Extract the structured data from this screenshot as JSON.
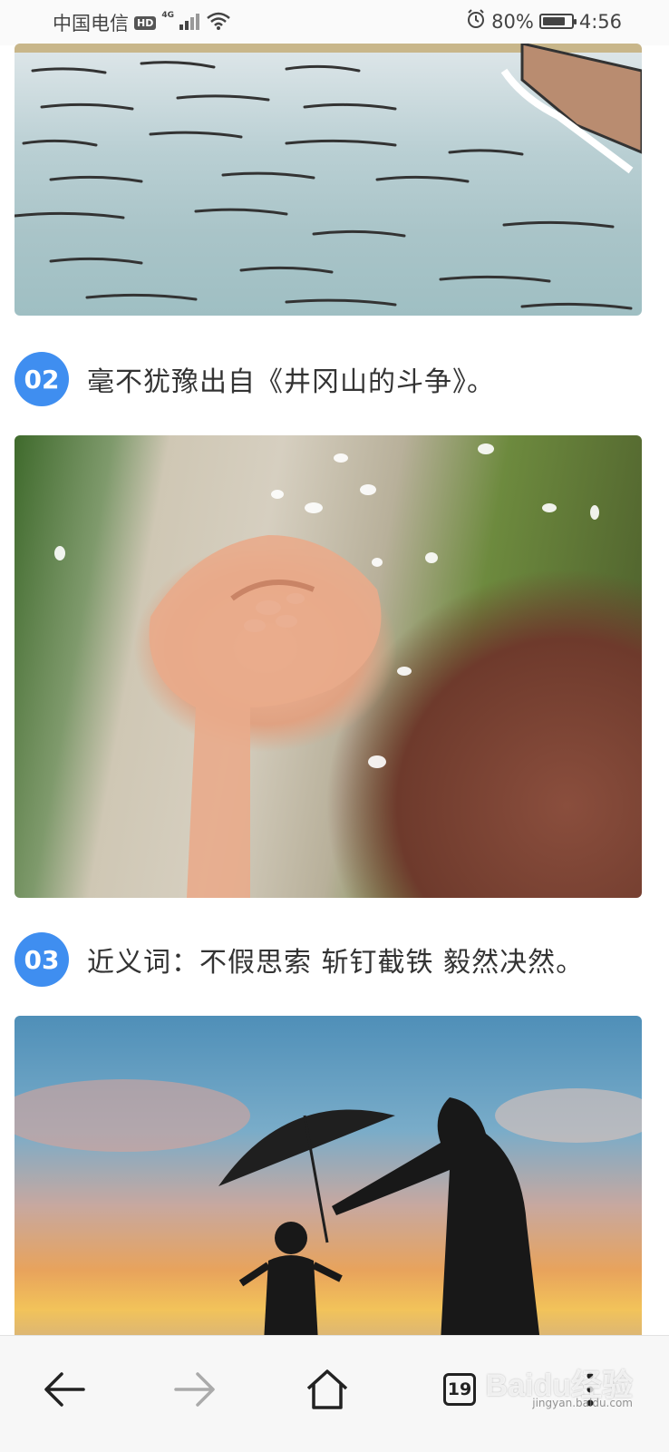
{
  "status_bar": {
    "carrier": "中国电信",
    "hd": "HD",
    "network": "4G",
    "battery_percent": "80%",
    "battery_level": 0.8,
    "time": "4:56"
  },
  "steps": [
    {
      "number": "02",
      "text": "毫不犹豫出自《井冈山的斗争》。"
    },
    {
      "number": "03",
      "text": "近义词：不假思索 斩钉截铁 毅然决然。"
    }
  ],
  "nav": {
    "tab_count": "19"
  },
  "watermark": {
    "logo_text": "Baidu经验",
    "url": "jingyan.baidu.com"
  },
  "colors": {
    "step_badge": "#3f8ef0",
    "nav_background": "#f7f7f7"
  }
}
